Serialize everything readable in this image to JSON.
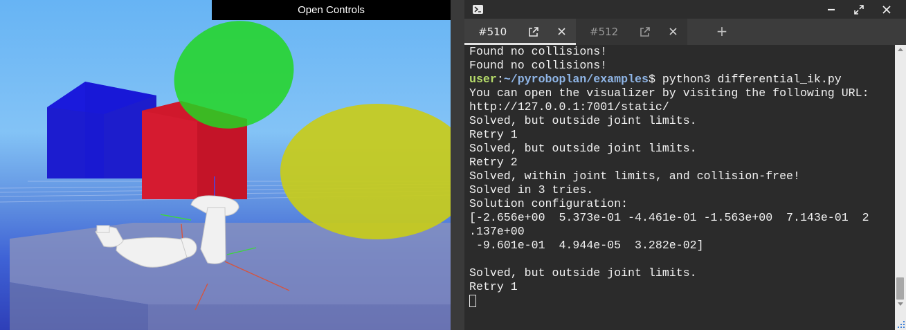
{
  "viewer": {
    "open_controls_label": "Open Controls",
    "scene_objects": [
      "blue-box",
      "red-box",
      "green-sphere",
      "yellow-sphere",
      "robot-arm",
      "table-slab"
    ]
  },
  "window": {
    "icons": [
      "powershell-icon",
      "minimize-icon",
      "maximize-icon",
      "close-icon"
    ]
  },
  "tabs": [
    {
      "label": "#510",
      "active": true
    },
    {
      "label": "#512",
      "active": false
    }
  ],
  "new_tab_label": "+",
  "console": {
    "prompt_user": "user",
    "prompt_sep": ":",
    "prompt_path": "~/pyroboplan/examples",
    "prompt_symbol": "$",
    "command": " python3 differential_ik.py",
    "lines_before": [
      "Found no collisions!",
      "Found no collisions!"
    ],
    "lines_after": [
      "You can open the visualizer by visiting the following URL:",
      "http://127.0.0.1:7001/static/",
      "Solved, but outside joint limits.",
      "Retry 1",
      "Solved, but outside joint limits.",
      "Retry 2",
      "Solved, within joint limits, and collision-free!",
      "Solved in 3 tries.",
      "Solution configuration:",
      "[-2.656e+00  5.373e-01 -4.461e-01 -1.563e+00  7.143e-01  2",
      ".137e+00",
      " -9.601e-01  4.944e-05  3.282e-02]",
      "",
      "Solved, but outside joint limits.",
      "Retry 1"
    ]
  },
  "colors": {
    "prompt_user": "#b6dc6a",
    "prompt_path": "#8fb5e6",
    "terminal_bg": "#2b2b2b",
    "terminal_fg": "#f2f2f2"
  }
}
